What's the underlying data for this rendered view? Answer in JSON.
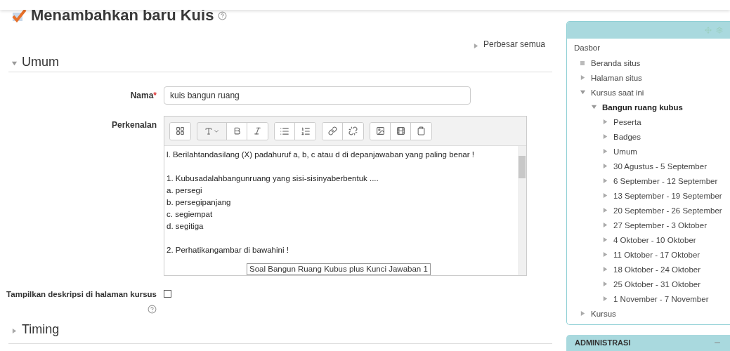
{
  "page_title": "Menambahkan baru Kuis",
  "expand_all": "Perbesar semua",
  "sections": [
    {
      "title": "Umum",
      "expanded": true
    },
    {
      "title": "Timing",
      "expanded": false
    }
  ],
  "form": {
    "name_label": "Nama",
    "name_value": "kuis bangun ruang",
    "intro_label": "Perkenalan",
    "required_mark": "*",
    "editor_paragraphs": [
      [
        "l. Berilahtandasilang (X) padahuruf a, b, c atau d di depanjawaban yang paling benar !"
      ],
      [
        "1. Kubusadalahbangunruang yang sisi-sisinyaberbentuk ....",
        "a. persegi",
        "b. persegipanjang",
        "c. segiempat",
        "d. segitiga"
      ],
      [
        "2. Perhatikangambar di bawahini !"
      ]
    ],
    "tooltip": "Soal Bangun Ruang Kubus plus Kunci Jawaban 1",
    "show_desc_label": "Tampilkan deskripsi di halaman kursus",
    "show_desc_checked": false
  },
  "navigation": {
    "root": "Dasbor",
    "items": [
      {
        "label": "Beranda situs"
      },
      {
        "label": "Halaman situs",
        "expanded": false
      },
      {
        "label": "Kursus saat ini",
        "expanded": true,
        "children": [
          {
            "label": "Bangun ruang kubus",
            "expanded": true,
            "current": true,
            "children": [
              {
                "label": "Peserta",
                "expanded": false
              },
              {
                "label": "Badges",
                "expanded": false
              },
              {
                "label": "Umum",
                "expanded": false
              },
              {
                "label": "30 Agustus - 5 September",
                "expanded": false
              },
              {
                "label": "6 September - 12 September",
                "expanded": false
              },
              {
                "label": "13 September - 19 September",
                "expanded": false
              },
              {
                "label": "20 September - 26 September",
                "expanded": false
              },
              {
                "label": "27 September - 3 Oktober",
                "expanded": false
              },
              {
                "label": "4 Oktober - 10 Oktober",
                "expanded": false
              },
              {
                "label": "11 Oktober - 17 Oktober",
                "expanded": false
              },
              {
                "label": "18 Oktober - 24 Oktober",
                "expanded": false
              },
              {
                "label": "25 Oktober - 31 Oktober",
                "expanded": false
              },
              {
                "label": "1 November - 7 November",
                "expanded": false
              }
            ]
          }
        ]
      },
      {
        "label": "Kursus",
        "expanded": false
      }
    ]
  },
  "admin_block": {
    "title": "ADMINISTRASI"
  }
}
